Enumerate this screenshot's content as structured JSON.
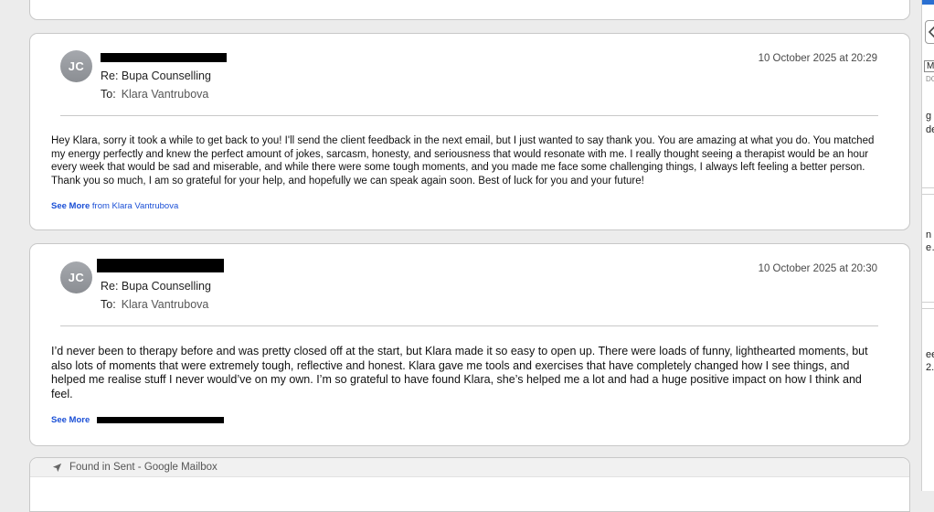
{
  "emails": [
    {
      "avatar_initials": "JC",
      "subject": "Re: Bupa Counselling",
      "to_label": "To:",
      "to_value": "Klara Vantrubova",
      "date": "10 October 2025 at 20:29",
      "body": "Hey Klara, sorry it took a while to get back to you! I'll send the client feedback in the next email, but I just wanted to say thank you. You are amazing at what you do. You matched my energy perfectly and knew the perfect amount of jokes, sarcasm, honesty, and seriousness that would resonate with me. I really thought seeing a therapist would be an hour every week that would be sad and miserable, and while there were some tough moments, and you made me face some challenging things, I always left feeling a better person. Thank you so much, I am so grateful for your help, and hopefully we can speak again soon. Best of luck for you and your future!",
      "see_more": "See More",
      "see_more_from": "from Klara Vantrubova"
    },
    {
      "avatar_initials": "JC",
      "subject": "Re: Bupa Counselling",
      "to_label": "To:",
      "to_value": "Klara Vantrubova",
      "date": "10 October 2025 at 20:30",
      "body": "I’d never been to therapy before and was pretty closed off at the start, but Klara made it so easy to open up. There were loads of funny, lighthearted moments, but also lots of moments that were extremely tough, reflective and honest. Klara gave me tools and exercises that have completely changed how I see things, and helped me realise stuff I never would’ve on my own. I’m so grateful to have found Klara, she’s helped me a lot and had a huge positive impact on how I think and feel.",
      "see_more": "See More"
    }
  ],
  "found_in": "Found in Sent - Google Mailbox",
  "side": {
    "t1": "M",
    "t2": "DO",
    "t3": "g",
    "t4": "de",
    "t5": "n",
    "t6": "e…",
    "t7": "ee",
    "t8": "2."
  },
  "colors": {
    "link": "#1a4fd6",
    "accent": "#2a6fd1"
  }
}
